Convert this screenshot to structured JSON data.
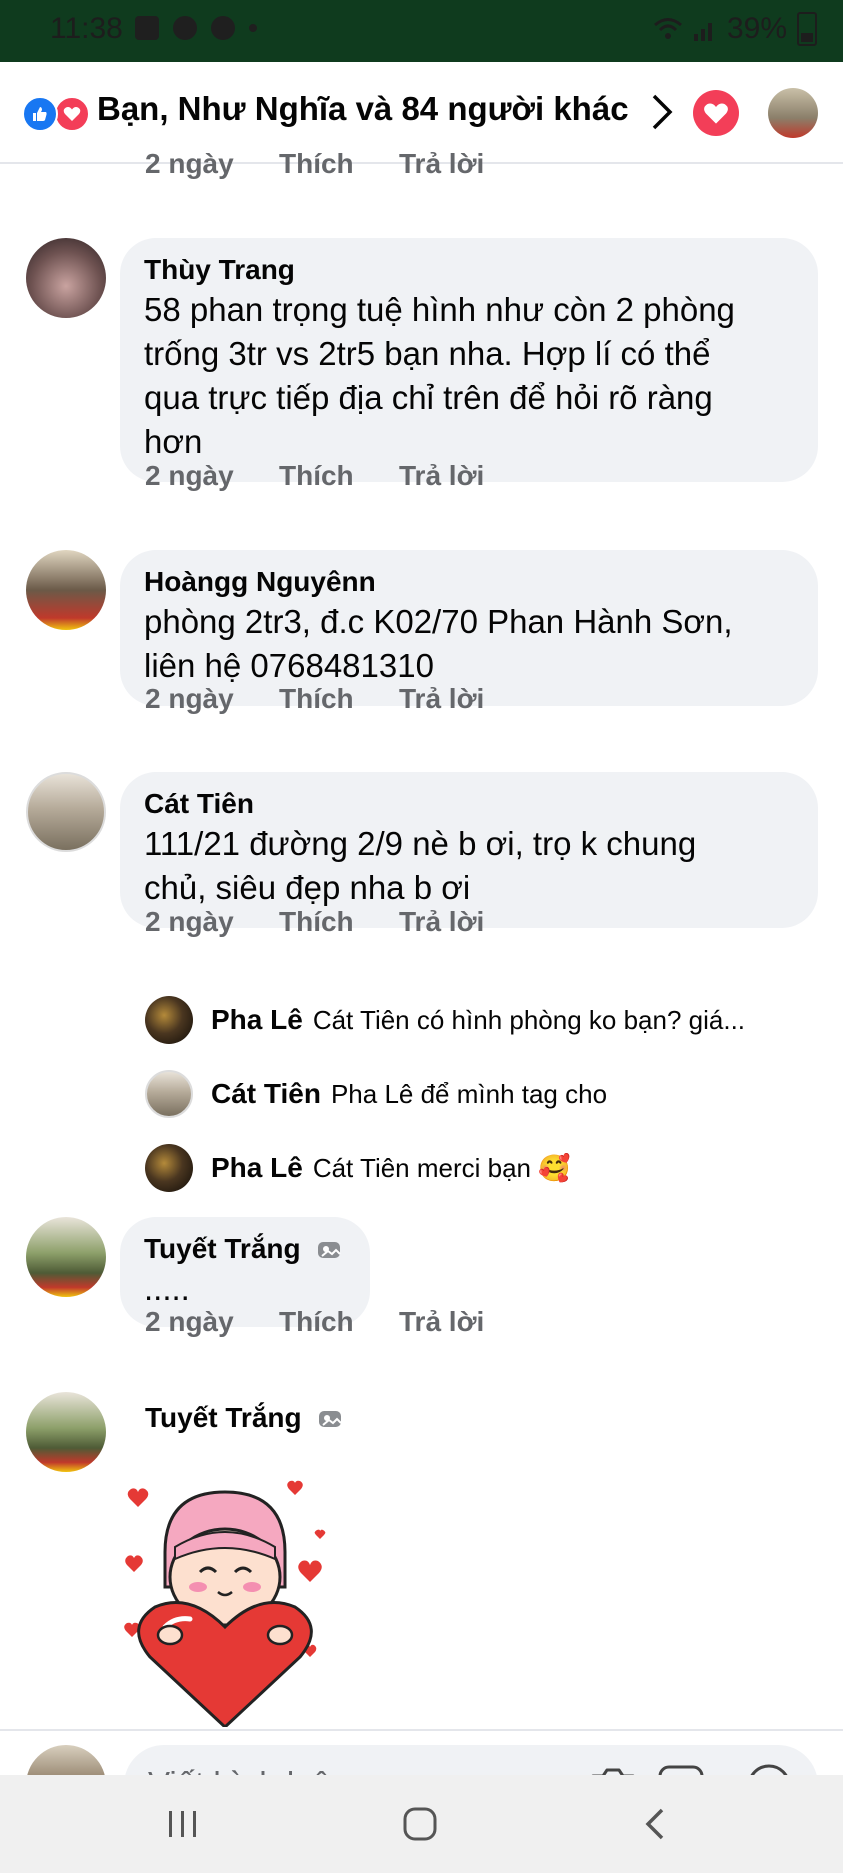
{
  "status_bar": {
    "time": "11:38",
    "battery": "39%"
  },
  "header": {
    "title": "Bạn, Như Nghĩa và 84 người khác"
  },
  "comments": [
    {
      "time": "2 ngày",
      "like": "Thích",
      "reply": "Trả lời"
    },
    {
      "name": "Thùy Trang",
      "lines": [
        "58 phan trọng tuệ hình như còn 2 phòng",
        "trống 3tr vs 2tr5 bạn nha. Hợp lí có thể",
        "qua trực tiếp địa chỉ trên để hỏi rõ ràng",
        "hơn"
      ],
      "time": "2 ngày",
      "like": "Thích",
      "reply": "Trả lời"
    },
    {
      "name": "Hoàngg Nguyênn",
      "lines": [
        "phòng 2tr3, đ.c K02/70 Phan Hành Sơn,",
        "liên hệ 0768481310"
      ],
      "time": "2 ngày",
      "like": "Thích",
      "reply": "Trả lời"
    },
    {
      "name": "Cát Tiên",
      "lines": [
        "111/21 đường 2/9 nè b ơi, trọ k chung",
        "chủ, siêu đẹp nha b ơi"
      ],
      "time": "2 ngày",
      "like": "Thích",
      "reply": "Trả lời"
    },
    {
      "name": "Tuyết Trắng",
      "lines": [
        "....."
      ],
      "time": "2 ngày",
      "like": "Thích",
      "reply": "Trả lời"
    },
    {
      "name": "Tuyết Trắng"
    }
  ],
  "replies": [
    {
      "name": "Pha Lê",
      "text": "Cát Tiên có hình phòng ko bạn? giá..."
    },
    {
      "name": "Cát Tiên",
      "text": "Pha Lê để mình tag cho"
    },
    {
      "name": "Pha Lê",
      "text": "Cát Tiên merci bạn 🥰"
    }
  ],
  "composer": {
    "placeholder": "Viết bình luận..."
  },
  "icons": [
    "like-reaction-icon",
    "love-reaction-icon",
    "chevron-right-icon",
    "heart-icon",
    "camera-icon",
    "gif-icon",
    "emoji-icon",
    "recent-apps-icon",
    "home-icon",
    "back-icon",
    "photo-badge-icon"
  ],
  "colors": {
    "like_blue": "#1877f2",
    "love_red": "#f33e58",
    "bubble_bg": "#f0f2f5",
    "meta_gray": "#65676b"
  }
}
